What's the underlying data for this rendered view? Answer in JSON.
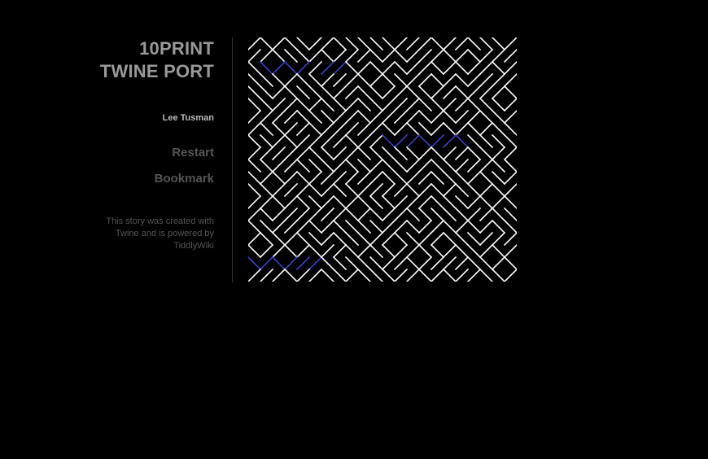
{
  "sidebar": {
    "title_line1": "10PRINT",
    "title_line2": "TWINE PORT",
    "author": "Lee Tusman",
    "restart_label": "Restart",
    "bookmark_label": "Bookmark",
    "credits_prefix": "This story was created with",
    "credits_twine": "Twine",
    "credits_middle": " and is powered by",
    "credits_tiddlywiki": "TiddlyWiki"
  },
  "maze": {
    "line_color": "#ffffff",
    "link_color": "#3b40c8",
    "background": "#000000"
  }
}
